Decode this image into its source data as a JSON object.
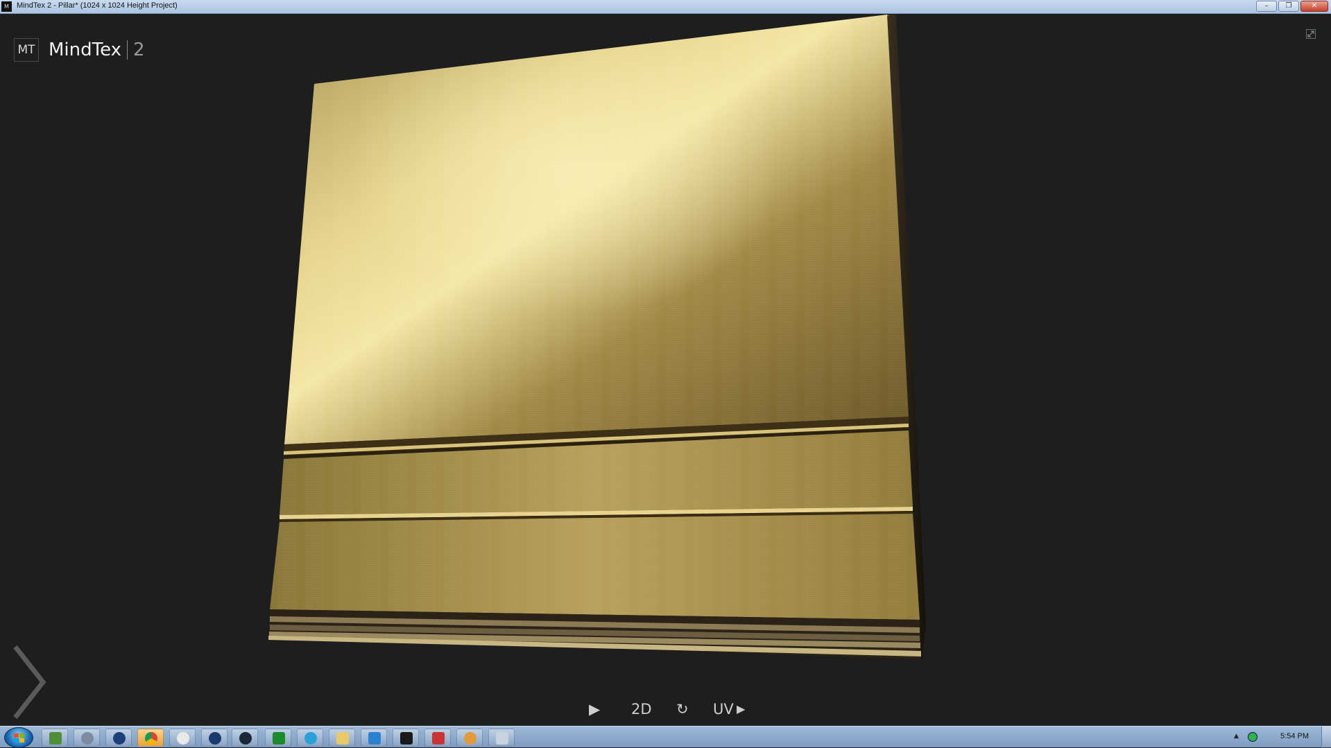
{
  "window": {
    "title": "MindTex 2 - Pillar* (1024 x 1024 Height Project)",
    "icon": "mindtex-app-icon",
    "icon_text": "M",
    "buttons": {
      "minimize": "–",
      "restore": "❐",
      "close": "✕"
    }
  },
  "logo": {
    "mark": "MT",
    "name": "MindTex",
    "version": "2"
  },
  "viewport": {
    "controls": {
      "play": "▶",
      "mode": "2D",
      "reset": "↻",
      "uv": "UV",
      "uv_arrow": "▶"
    },
    "panel_toggle_icon": "chevron-right-icon",
    "expand_icon": "fullscreen-icon",
    "material_colors": {
      "light": "#f1e2a0",
      "mid": "#b59b55",
      "dark": "#5d4a22",
      "edge": "#2a241a"
    }
  },
  "taskbar": {
    "start": "start-orb",
    "apps": [
      "windows-explorer-green-icon",
      "tool-icon",
      "globe-icon",
      "chrome-icon",
      "alien-icon",
      "globe-icon-2",
      "steam-icon",
      "chart-app-icon",
      "telegram-icon",
      "folder-icon",
      "g-app-icon",
      "mindtex-task-icon",
      "red-app-icon",
      "paint-icon",
      "misc-app-icon"
    ],
    "clock": "5:54 PM",
    "tray_arrow": "▲"
  }
}
